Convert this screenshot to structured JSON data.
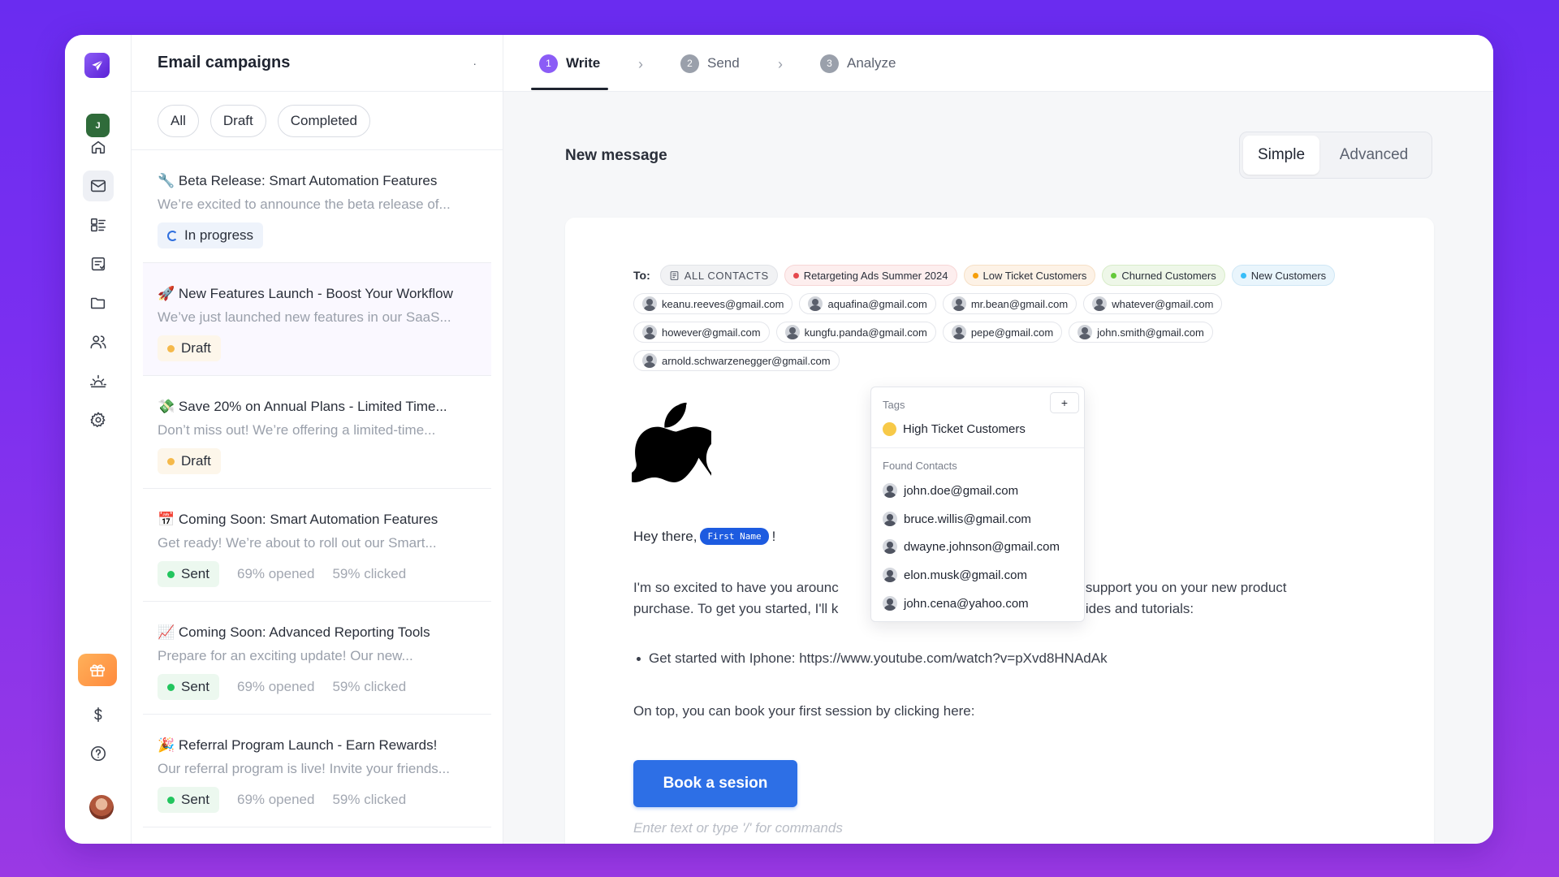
{
  "sidebar": {
    "workspace_initial": "J",
    "nav": [
      "home-icon",
      "mail-icon",
      "contacts-icon",
      "templates-icon",
      "folder-icon",
      "users-icon",
      "sunrise-icon",
      "gear-icon"
    ],
    "bottom": [
      "gift-icon",
      "dollar-icon",
      "help-icon"
    ]
  },
  "campaigns": {
    "title": "Email campaigns",
    "menu_glyph": "·",
    "filters": [
      "All",
      "Draft",
      "Completed"
    ],
    "items": [
      {
        "emoji": "🔧",
        "title": "Beta Release: Smart Automation Features",
        "preview": "We’re excited to announce the beta release of...",
        "status": "In progress",
        "opened": "",
        "clicked": ""
      },
      {
        "emoji": "🚀",
        "title": "New Features Launch - Boost Your Workflow",
        "preview": "We’ve just launched new features in our SaaS...",
        "status": "Draft",
        "opened": "",
        "clicked": ""
      },
      {
        "emoji": "💸",
        "title": "Save 20% on Annual Plans - Limited Time...",
        "preview": "Don’t miss out! We’re offering a limited-time...",
        "status": "Draft",
        "opened": "",
        "clicked": ""
      },
      {
        "emoji": "📅",
        "title": "Coming Soon: Smart Automation Features",
        "preview": "Get ready! We’re about to roll out our Smart...",
        "status": "Sent",
        "opened": "69% opened",
        "clicked": "59% clicked"
      },
      {
        "emoji": "📈",
        "title": "Coming Soon: Advanced Reporting Tools",
        "preview": "Prepare for an exciting update! Our new...",
        "status": "Sent",
        "opened": "69% opened",
        "clicked": "59% clicked"
      },
      {
        "emoji": "🎉",
        "title": "Referral Program Launch - Earn Rewards!",
        "preview": "Our referral program is live! Invite your friends...",
        "status": "Sent",
        "opened": "69% opened",
        "clicked": "59% clicked"
      }
    ]
  },
  "steps": [
    {
      "num": "1",
      "label": "Write"
    },
    {
      "num": "2",
      "label": "Send"
    },
    {
      "num": "3",
      "label": "Analyze"
    }
  ],
  "editor": {
    "heading": "New message",
    "mode_simple": "Simple",
    "mode_advanced": "Advanced",
    "to_label": "To:",
    "all_contacts": "ALL CONTACTS",
    "tags": [
      {
        "label": "Retargeting Ads Summer 2024",
        "color": "#e5484d"
      },
      {
        "label": "Low Ticket Customers",
        "color": "#f59e0b"
      },
      {
        "label": "Churned Customers",
        "color": "#65c93a"
      },
      {
        "label": "New Customers",
        "color": "#38bdf8"
      }
    ],
    "recipients": [
      "keanu.reeves@gmail.com",
      "aquafina@gmail.com",
      "mr.bean@gmail.com",
      "whatever@gmail.com",
      "however@gmail.com",
      "kungfu.panda@gmail.com",
      "pepe@gmail.com",
      "john.smith@gmail.com",
      "arnold.schwarzenegger@gmail.com"
    ],
    "greeting_prefix": "Hey there,",
    "first_name_var": "First Name",
    "greeting_suffix": "!",
    "para_left_1": "I'm so excited to have you arounc",
    "para_right_1": "to support you on your new product",
    "para_left_2": "purchase. To get you started, I'll k",
    "para_right_2": "guides and tutorials:",
    "bullet": "Get started with Iphone: https://www.youtube.com/watch?v=pXvd8HNAdAk",
    "book_text": "On top, you can book your first session by clicking here:",
    "book_button": "Book a sesion",
    "placeholder": "Enter text or type '/' for commands"
  },
  "dropdown": {
    "tags_label": "Tags",
    "add_glyph": "+",
    "tag": "High Ticket Customers",
    "tag_color": "#f7c948",
    "contacts_label": "Found Contacts",
    "contacts": [
      "john.doe@gmail.com",
      "bruce.willis@gmail.com",
      "dwayne.johnson@gmail.com",
      "elon.musk@gmail.com",
      "john.cena@yahoo.com"
    ]
  },
  "colors": {
    "accent": "#8b5cf6",
    "primary_button": "#2d6fe6",
    "sent": "#22c55e",
    "draft": "#f5b94a"
  }
}
